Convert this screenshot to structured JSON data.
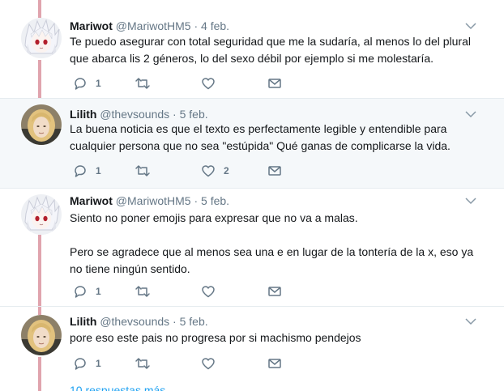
{
  "tweets": [
    {
      "name": "Mariwot",
      "handle": "@MariwotHM5",
      "sep": "·",
      "date": "4 feb.",
      "avatar": "anime-white-hair-avatar",
      "lines": [
        "Te puedo asegurar con total seguridad que me la sudaría,  al menos lo del plural",
        "que abarca lis 2 géneros,  lo del sexo débil por ejemplo si me molestaría."
      ],
      "actions": {
        "reply": "1",
        "retweet": "",
        "like": ""
      }
    },
    {
      "name": "Lilith",
      "handle": "@thevsounds",
      "sep": "·",
      "date": "5 feb.",
      "avatar": "blonde-woman-avatar",
      "lines": [
        "La buena noticia es que el texto es perfectamente legible y entendible para",
        "cualquier persona que no sea \"estúpida\" Qué ganas de complicarse la vida."
      ],
      "actions": {
        "reply": "1",
        "retweet": "",
        "like": "2"
      }
    },
    {
      "name": "Mariwot",
      "handle": "@MariwotHM5",
      "sep": "·",
      "date": "5 feb.",
      "avatar": "anime-white-hair-avatar",
      "lines": [
        "Siento no poner emojis para expresar que no va a malas.",
        "",
        "Pero se agradece que al menos sea una e en lugar de la tontería de la x,  eso ya",
        "no tiene ningún sentido."
      ],
      "actions": {
        "reply": "1",
        "retweet": "",
        "like": ""
      }
    },
    {
      "name": "Lilith",
      "handle": "@thevsounds",
      "sep": "·",
      "date": "5 feb.",
      "avatar": "blonde-woman-avatar",
      "lines": [
        "pore eso este pais no progresa por si machismo pendejos"
      ],
      "actions": {
        "reply": "1",
        "retweet": "",
        "like": ""
      }
    }
  ],
  "more_replies": "10 respuestas más",
  "colors": {
    "thread": "#e0a4ae",
    "muted": "#657786",
    "link": "#1da1f2",
    "highlight": "#f5f8fa"
  },
  "icons": [
    "reply-icon",
    "retweet-icon",
    "like-icon",
    "direct-message-icon",
    "chevron-down-icon"
  ]
}
